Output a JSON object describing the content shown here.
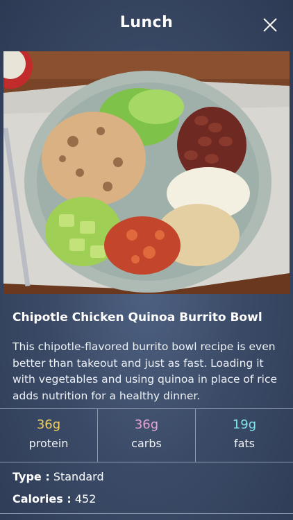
{
  "header": {
    "title": "Lunch"
  },
  "recipe": {
    "name": "Chipotle Chicken Quinoa Burrito Bowl",
    "description": "This chipotle-flavored burrito bowl recipe is even better than takeout and just as fast. Loading it with vegetables and using quinoa in place of rice adds nutrition for a healthy dinner."
  },
  "macros": [
    {
      "value": "36g",
      "label": "protein",
      "color": "#f1cf5c"
    },
    {
      "value": "36g",
      "label": "carbs",
      "color": "#e7a3d2"
    },
    {
      "value": "19g",
      "label": "fats",
      "color": "#7fe3ea"
    }
  ],
  "details": {
    "type_label": "Type :",
    "type_value": "Standard",
    "calories_label": "Calories :",
    "calories_value": "452"
  }
}
